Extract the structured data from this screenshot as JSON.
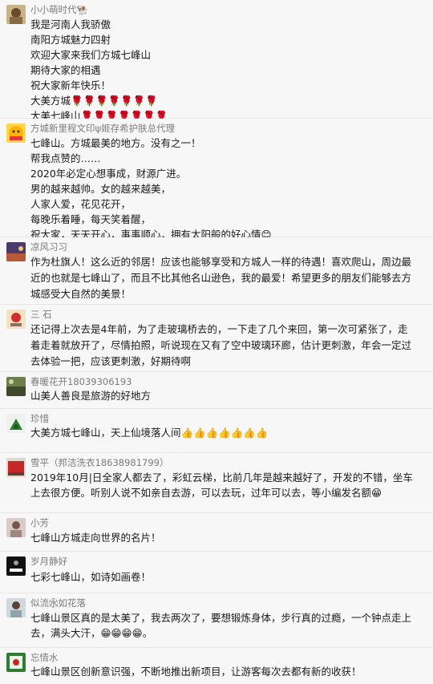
{
  "comments": [
    {
      "name": "小小萌时代",
      "name_suffix": "🐏",
      "lines": [
        "我是河南人我骄傲",
        "南阳方城魅力四射",
        "欢迎大家来我们方城七峰山",
        "期待大家的相遇",
        "祝大家新年快乐！",
        "大美方城🌹🌹🌹🌹🌹🌹🌹",
        "大美七峰山🌹🌹🌹🌹🌹🌹🌹"
      ]
    },
    {
      "name": "方城新里程文印ψ姬存希护肤总代理",
      "lines": [
        "七峰山。方城最美的地方。没有之一！",
        "帮我点赞的……",
        "2020年必定心想事成，财源广进。",
        "男的越来越帅。女的越来越美，",
        "人家人爱，花见花开，",
        "每晚乐着睡，每天笑着醒，",
        "祝大家，天天开心，事事顺心，拥有太阳般的好心情😊"
      ]
    },
    {
      "name": "凉风习习",
      "lines": [
        "作为杜旗人！这么近的邻居！应该也能够享受和方城人一样的待遇！喜欢爬山，周边最",
        "近的也就是七峰山了，而且不比其他名山逊色，我的最爱！希望更多的朋友们能够去方",
        "城感受大自然的美景！"
      ]
    },
    {
      "name": "三 石",
      "lines": [
        "还记得上次去是4年前，为了走玻璃桥去的，一下走了几个来回，第一次可紧张了，走",
        "着走着就放开了，尽情拍照，听说现在又有了空中玻璃环廊，估计更刺激，年会一定过",
        "去体验一把，应该更刺激，好期待啊"
      ]
    },
    {
      "name": "春暖花开18039306193",
      "lines": [
        "山美人善良是旅游的好地方"
      ]
    },
    {
      "name": "珍惜",
      "lines": [
        "大美方城七峰山，天上仙境落人间👍👍👍👍👍👍👍"
      ]
    },
    {
      "name": "雪平（邦洁洗衣18638981799）",
      "lines": [
        "2019年10月|日全家人都去了，彩虹云梯，比前几年是越来越好了，开发的不错，坐车",
        "上去很方便。听别人说不如亲自去游，可以去玩，过年可以去，等小编发名额😁"
      ]
    },
    {
      "name": "小芳",
      "lines": [
        "七峰山方城走向世界的名片！"
      ]
    },
    {
      "name": "岁月静好",
      "lines": [
        "七彩七峰山，如诗如画卷！"
      ]
    },
    {
      "name": "似流水⃝如花落",
      "lines": [
        "七峰山景区真的是太美了，我去两次了，要想锻炼身体，步行真的过瘾，一个钟点走上",
        "去，满头大汗，😁😁😁😁。"
      ]
    },
    {
      "name": "忘情水",
      "lines": [
        "七峰山景区创新意识强，不断地推出新项目，让游客每次去都有新的收获！"
      ]
    }
  ]
}
